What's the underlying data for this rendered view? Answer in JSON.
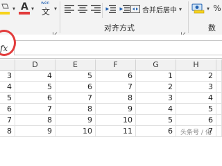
{
  "ribbon": {
    "alignment_group_label": "对齐方式",
    "number_group_label_partial": "数字",
    "merge_center_label": "合并后居中",
    "dropdown_arrow": "▾",
    "wen_label": "wén",
    "wen_char": "文",
    "font_color_letter": "A",
    "percent_symbol": "%",
    "accent_red": "#e23b3b",
    "fill_yellow": "#f7d31b"
  },
  "formula_bar": {
    "fx_label": "fx",
    "value": ""
  },
  "columns": [
    "D",
    "E",
    "F",
    "G",
    "H"
  ],
  "rows": [
    [
      "3",
      "4",
      "5",
      "6",
      "1",
      "2"
    ],
    [
      "4",
      "5",
      "6",
      "7",
      "2",
      "3"
    ],
    [
      "5",
      "6",
      "7",
      "8",
      "3",
      "4"
    ],
    [
      "6",
      "7",
      "8",
      "9",
      "4",
      "5"
    ],
    [
      "7",
      "8",
      "9",
      "10",
      "5",
      "6"
    ],
    [
      "8",
      "9",
      "10",
      "11",
      "6",
      "7"
    ]
  ],
  "watermark": "头条号 / 化"
}
